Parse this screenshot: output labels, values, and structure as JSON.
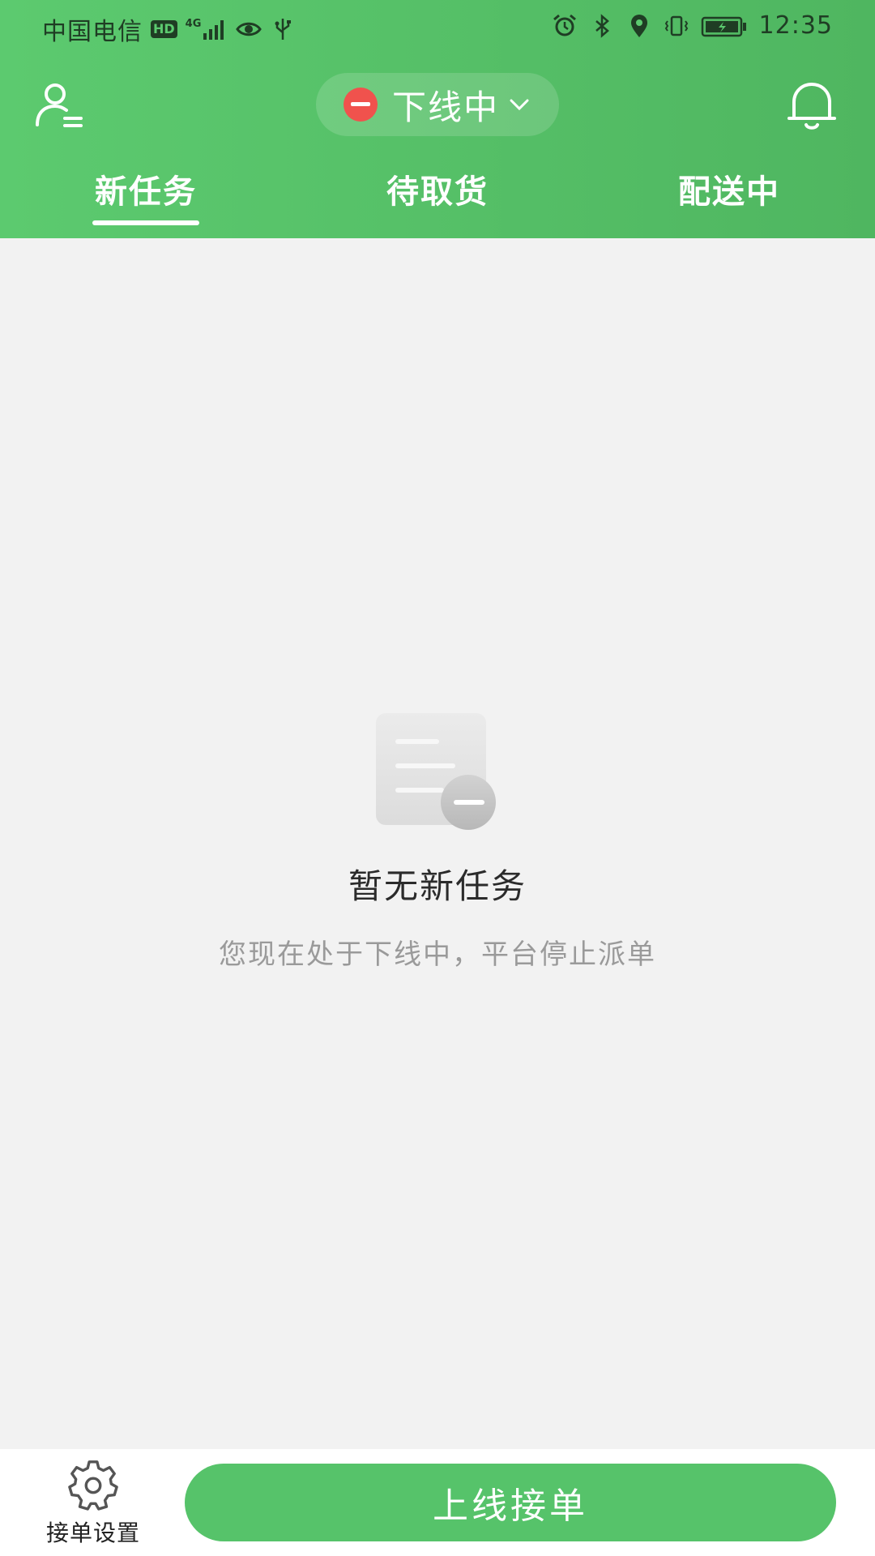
{
  "status_bar": {
    "carrier": "中国电信",
    "hd_badge": "HD",
    "network_label": "4G",
    "time": "12:35",
    "left_icons": [
      "hd-badge",
      "signal-icon",
      "eye-icon",
      "usb-icon"
    ],
    "right_icons": [
      "alarm-icon",
      "bluetooth-icon",
      "location-icon",
      "vibrate-icon",
      "battery-charging-icon"
    ]
  },
  "header": {
    "status_label": "下线中",
    "status_color": "#f0524d",
    "header_color": "#5cca6f",
    "tabs": [
      {
        "label": "新任务",
        "active": true
      },
      {
        "label": "待取货",
        "active": false
      },
      {
        "label": "配送中",
        "active": false
      }
    ]
  },
  "empty_state": {
    "title": "暂无新任务",
    "subtitle": "您现在处于下线中，平台停止派单"
  },
  "bottom_bar": {
    "settings_label": "接单设置",
    "go_online_label": "上线接单",
    "button_color": "#56c36a"
  }
}
